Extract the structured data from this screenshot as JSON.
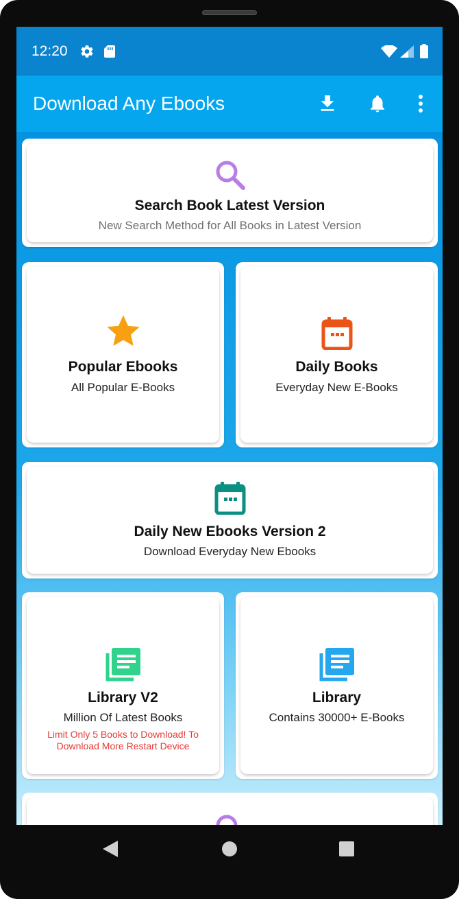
{
  "status_bar": {
    "time": "12:20"
  },
  "app_bar": {
    "title": "Download Any Ebooks",
    "actions": [
      "download-icon",
      "bell-icon",
      "more-vert-icon"
    ]
  },
  "tiles": {
    "search": {
      "title": "Search Book Latest Version",
      "subtitle": "New Search Method for All Books in Latest Version",
      "icon": "search-icon",
      "icon_color": "#b97ee6"
    },
    "popular": {
      "title": "Popular Ebooks",
      "subtitle": "All Popular E-Books",
      "icon": "star-icon",
      "icon_color": "#f7a012"
    },
    "daily": {
      "title": "Daily Books",
      "subtitle": "Everyday New E-Books",
      "icon": "calendar-icon",
      "icon_color": "#ea5517"
    },
    "daily_v2": {
      "title": "Daily New Ebooks Version 2",
      "subtitle": "Download Everyday New Ebooks",
      "icon": "calendar-icon",
      "icon_color": "#0b8f82"
    },
    "library_v2": {
      "title": "Library V2",
      "subtitle": "Million Of Latest Books",
      "warning_line1": "Limit Only 5 Books to Download! To",
      "warning_line2": "Download More Restart Device",
      "icon": "library-icon",
      "icon_color": "#2fd38c"
    },
    "library": {
      "title": "Library",
      "subtitle": "Contains 30000+ E-Books",
      "icon": "library-icon",
      "icon_color": "#24a7ee"
    }
  },
  "nav_bar": {
    "buttons": [
      "back-icon",
      "home-icon",
      "recents-icon"
    ]
  }
}
